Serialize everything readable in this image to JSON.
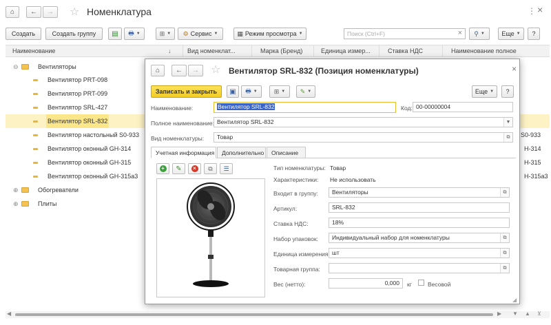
{
  "window": {
    "title": "Номенклатура",
    "close": "×",
    "more": "⋮"
  },
  "toolbar": {
    "create": "Создать",
    "create_group": "Создать группу",
    "service": "Сервис",
    "view_mode": "Режим просмотра",
    "search_placeholder": "Поиск (Ctrl+F)",
    "more": "Еще",
    "help": "?"
  },
  "columns": [
    "Наименование",
    "Вид номенклат...",
    "Марка (Бренд)",
    "Единица измер...",
    "Ставка НДС",
    "Наименование полное"
  ],
  "sort_indicator": "↓",
  "tree": {
    "group1": "Вентиляторы",
    "items": [
      {
        "name": "Вентилятор PRT-098",
        "full": ""
      },
      {
        "name": "Вентилятор PRT-099",
        "full": ""
      },
      {
        "name": "Вентилятор SRL-427",
        "full": ""
      },
      {
        "name": "Вентилятор SRL-832",
        "full": ""
      },
      {
        "name": "Вентилятор настольный S0-933",
        "full": "S0-933"
      },
      {
        "name": "Вентилятор оконный GH-314",
        "full": "H-314"
      },
      {
        "name": "Вентилятор оконный GH-315",
        "full": "H-315"
      },
      {
        "name": "Вентилятор оконный GH-315а3",
        "full": "H-315а3"
      }
    ],
    "group2": "Обогреватели",
    "group3": "Плиты"
  },
  "modal": {
    "title": "Вентилятор SRL-832 (Позиция номенклатуры)",
    "save_close": "Записать и закрыть",
    "more": "Еще",
    "help": "?",
    "close": "×",
    "name_label": "Наименование:",
    "name_value": "Вентилятор SRL-832",
    "code_label": "Код:",
    "code_value": "00-00000004",
    "full_name_label": "Полное наименование:",
    "full_name_value": "Вентилятор SRL-832",
    "kind_label": "Вид номенклатуры:",
    "kind_value": "Товар",
    "tabs": [
      "Учетная информация",
      "Дополнительно",
      "Описание"
    ],
    "type_label": "Тип номенклатуры:",
    "type_value": "Товар",
    "chars_label": "Характеристики:",
    "chars_value": "Не использовать",
    "group_label": "Входит в группу:",
    "group_value": "Вентиляторы",
    "article_label": "Артикул:",
    "article_value": "SRL-832",
    "vat_label": "Ставка НДС:",
    "vat_value": "18%",
    "pack_label": "Набор упаковок:",
    "pack_value": "Индивидуальный набор для номенклатуры",
    "unit_label": "Единица измерения:",
    "unit_value": "шт",
    "goods_group_label": "Товарная группа:",
    "goods_group_value": "",
    "weight_label": "Вес (нетто):",
    "weight_value": "0,000",
    "weight_unit": "кг",
    "weighted_label": "Весовой"
  }
}
